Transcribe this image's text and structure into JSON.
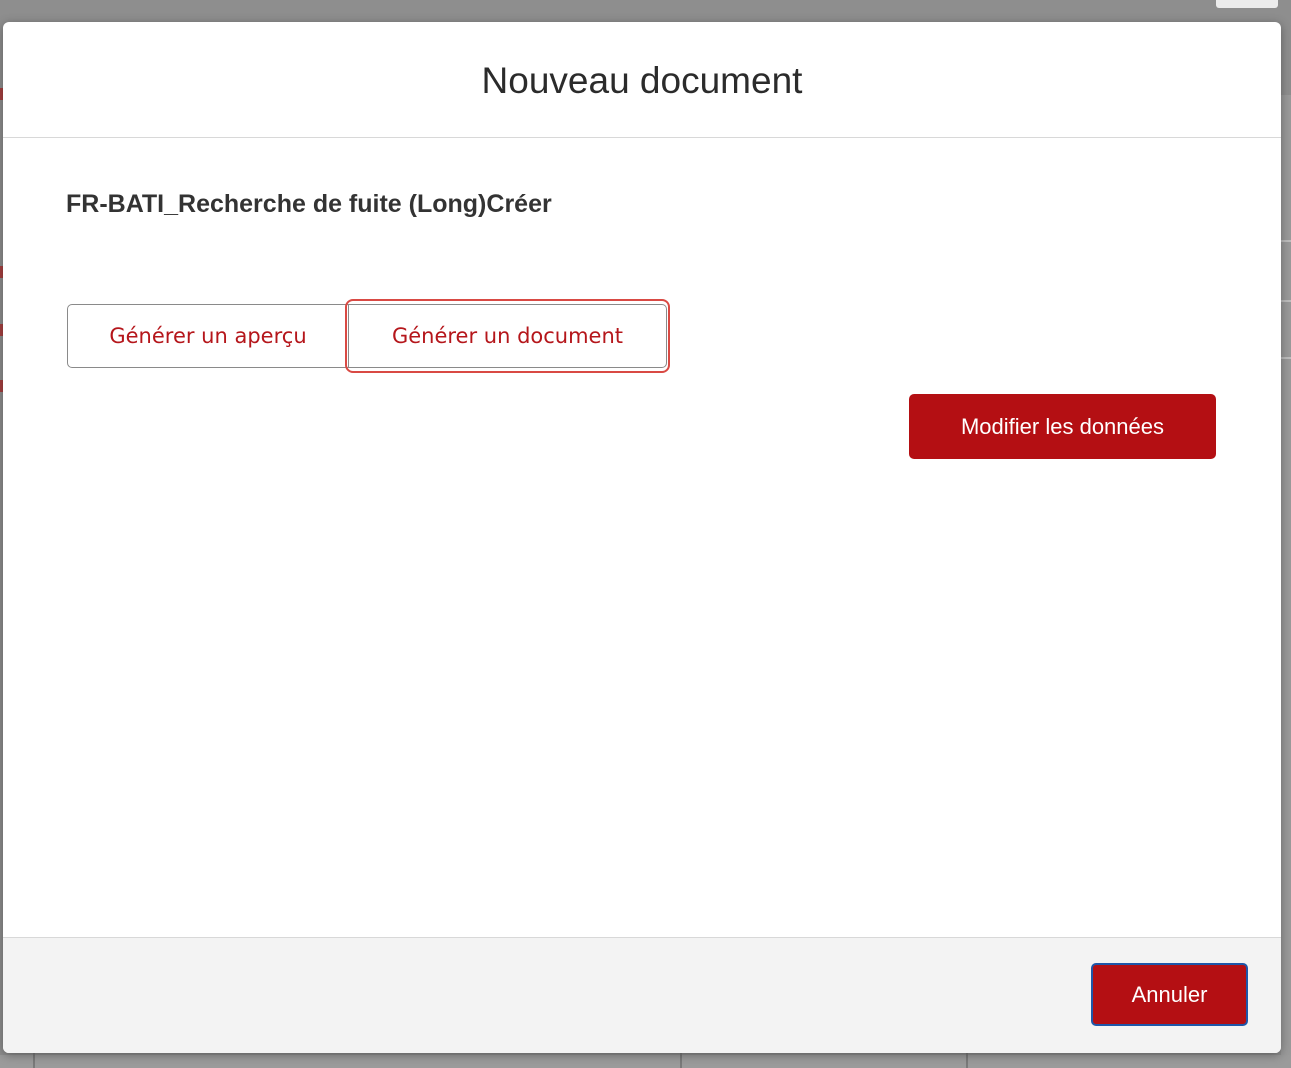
{
  "dialog": {
    "title": "Nouveau document",
    "template_name": "FR-BATI_Recherche de fuite (Long)Créer",
    "buttons": {
      "preview_label": "Générer un aperçu",
      "generate_label": "Générer un document",
      "modify_label": "Modifier les données",
      "cancel_label": "Annuler"
    },
    "colors": {
      "brand_red": "#b40f13",
      "focus_ring": "#d94a44",
      "cancel_focus_border": "#1f56a8"
    }
  }
}
